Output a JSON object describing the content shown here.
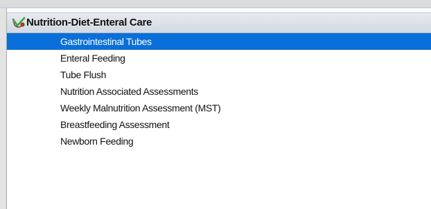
{
  "header": {
    "icon": "stethoscope-check-icon",
    "title": "Nutrition-Diet-Enteral Care"
  },
  "list": {
    "selected_index": 0,
    "selected_color": "#0a6fd8",
    "items": [
      {
        "label": "Gastrointestinal Tubes"
      },
      {
        "label": "Enteral Feeding"
      },
      {
        "label": "Tube Flush"
      },
      {
        "label": "Nutrition Associated Assessments"
      },
      {
        "label": "Weekly Malnutrition Assessment (MST)"
      },
      {
        "label": "Breastfeeding Assessment"
      },
      {
        "label": "Newborn Feeding"
      }
    ]
  }
}
